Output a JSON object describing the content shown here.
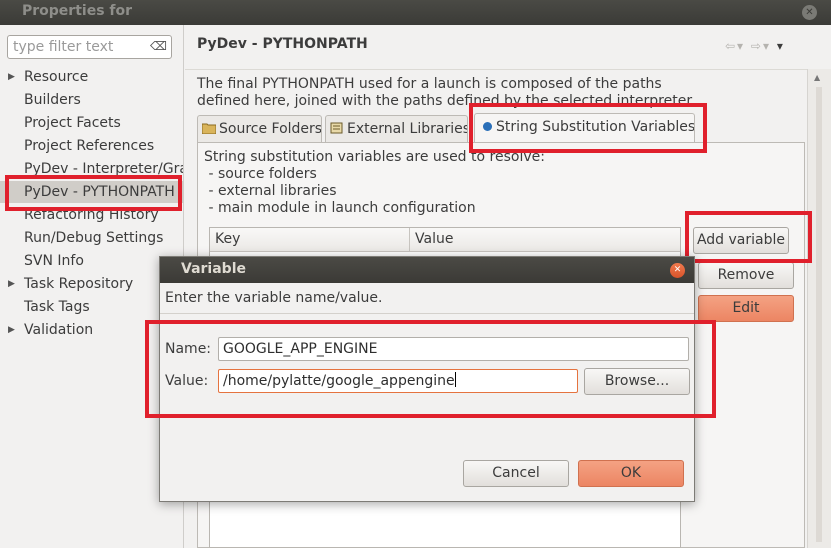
{
  "window": {
    "title": "Properties for"
  },
  "left": {
    "filter_placeholder": "type filter text",
    "items": [
      {
        "label": "Resource",
        "expandable": true
      },
      {
        "label": "Builders",
        "expandable": false
      },
      {
        "label": "Project Facets",
        "expandable": false
      },
      {
        "label": "Project References",
        "expandable": false
      },
      {
        "label": "PyDev - Interpreter/Grammar",
        "expandable": false
      },
      {
        "label": "PyDev - PYTHONPATH",
        "expandable": false,
        "selected": true
      },
      {
        "label": "Refactoring History",
        "expandable": false
      },
      {
        "label": "Run/Debug Settings",
        "expandable": false
      },
      {
        "label": "SVN Info",
        "expandable": false
      },
      {
        "label": "Task Repository",
        "expandable": true
      },
      {
        "label": "Task Tags",
        "expandable": false
      },
      {
        "label": "Validation",
        "expandable": true
      }
    ]
  },
  "page": {
    "title": "PyDev - PYTHONPATH",
    "description_line1": "The final PYTHONPATH used for a launch is composed of the paths",
    "description_line2": "defined here, joined with the paths defined by the selected interpreter",
    "tabs": [
      {
        "label": "Source Folders"
      },
      {
        "label": "External Libraries"
      },
      {
        "label": "String Substitution Variables",
        "active": true
      }
    ],
    "tab_description": "String substitution variables are used to resolve:\n - source folders\n - external libraries\n - main module in launch configuration",
    "table": {
      "col_key": "Key",
      "col_value": "Value"
    },
    "buttons": {
      "add": "Add variable",
      "remove": "Remove",
      "edit": "Edit"
    }
  },
  "dialog": {
    "title": "Variable",
    "message": "Enter the variable name/value.",
    "name_label": "Name:",
    "name_value": "GOOGLE_APP_ENGINE",
    "value_label": "Value:",
    "value_value": "/home/pylatte/google_appengine",
    "browse_label": "Browse...",
    "cancel_label": "Cancel",
    "ok_label": "OK"
  },
  "colors": {
    "highlight": "#e0202c",
    "accent_orange": "#ec8563",
    "title_bar": "#3b3b37"
  }
}
